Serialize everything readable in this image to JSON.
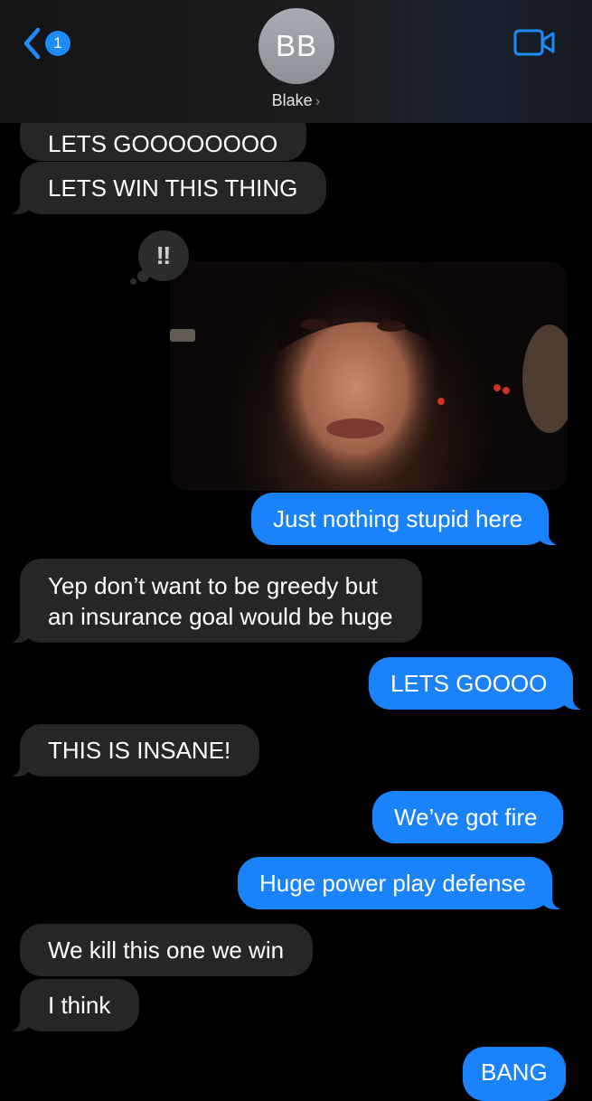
{
  "header": {
    "back_badge": "1",
    "avatar_initials": "BB",
    "contact_name": "Blake",
    "name_chevron": "›",
    "icons": {
      "back": "chevron-left-icon",
      "video": "video-camera-icon"
    },
    "accent_color": "#1a82fb"
  },
  "reaction": {
    "glyph": "‼",
    "icon": "exclamation-reaction-icon"
  },
  "messages": [
    {
      "from": "Blake",
      "type": "text",
      "text": "LETS GOOOOOOOO"
    },
    {
      "from": "Blake",
      "type": "text",
      "text": "LETS WIN THIS THING"
    },
    {
      "from": "me",
      "type": "image",
      "reaction": "‼"
    },
    {
      "from": "me",
      "type": "text",
      "text": "Just nothing stupid here"
    },
    {
      "from": "Blake",
      "type": "text",
      "line1": "Yep don’t want to be greedy but",
      "line2": "an insurance goal would be huge"
    },
    {
      "from": "me",
      "type": "text",
      "text": "LETS GOOOO"
    },
    {
      "from": "Blake",
      "type": "text",
      "text": "THIS IS INSANE!"
    },
    {
      "from": "me",
      "type": "text",
      "text": "We’ve got fire"
    },
    {
      "from": "me",
      "type": "text",
      "text": "Huge power play defense"
    },
    {
      "from": "Blake",
      "type": "text",
      "text": "We kill this one we win"
    },
    {
      "from": "Blake",
      "type": "text",
      "text": "I think"
    },
    {
      "from": "me",
      "type": "text",
      "text": "BANG"
    }
  ]
}
